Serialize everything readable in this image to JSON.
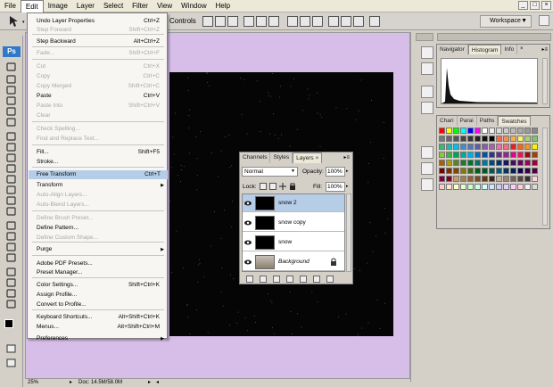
{
  "menubar": {
    "items": [
      "File",
      "Edit",
      "Image",
      "Layer",
      "Select",
      "Filter",
      "View",
      "Window",
      "Help"
    ],
    "active": "Edit",
    "window_controls": [
      "_",
      "□",
      "×"
    ]
  },
  "optionsbar": {
    "controls_label": "Controls",
    "workspace_label": "Workspace",
    "workspace_arrow": "▼"
  },
  "toolbox": {
    "logo": "Ps"
  },
  "edit_menu": {
    "items": [
      {
        "label": "Undo Layer Properties",
        "shortcut": "Ctrl+Z",
        "disabled": false
      },
      {
        "label": "Step Forward",
        "shortcut": "Shift+Ctrl+Z",
        "disabled": true
      },
      {
        "label": "Step Backward",
        "shortcut": "Alt+Ctrl+Z",
        "disabled": false
      },
      {
        "label": "Fade...",
        "shortcut": "Shift+Ctrl+F",
        "disabled": true
      },
      {
        "label": "Cut",
        "shortcut": "Ctrl+X",
        "disabled": true
      },
      {
        "label": "Copy",
        "shortcut": "Ctrl+C",
        "disabled": true
      },
      {
        "label": "Copy Merged",
        "shortcut": "Shift+Ctrl+C",
        "disabled": true
      },
      {
        "label": "Paste",
        "shortcut": "Ctrl+V",
        "disabled": false
      },
      {
        "label": "Paste Into",
        "shortcut": "Shift+Ctrl+V",
        "disabled": true
      },
      {
        "label": "Clear",
        "shortcut": "",
        "disabled": true
      },
      {
        "label": "Check Spelling...",
        "shortcut": "",
        "disabled": true
      },
      {
        "label": "Find and Replace Text...",
        "shortcut": "",
        "disabled": true
      },
      {
        "label": "Fill...",
        "shortcut": "Shift+F5",
        "disabled": false
      },
      {
        "label": "Stroke...",
        "shortcut": "",
        "disabled": false
      },
      {
        "label": "Free Transform",
        "shortcut": "Ctrl+T",
        "disabled": false,
        "highlight": true
      },
      {
        "label": "Transform",
        "shortcut": "",
        "disabled": false,
        "submenu": true
      },
      {
        "label": "Auto-Align Layers...",
        "shortcut": "",
        "disabled": true
      },
      {
        "label": "Auto-Blend Layers...",
        "shortcut": "",
        "disabled": true
      },
      {
        "label": "Define Brush Preset...",
        "shortcut": "",
        "disabled": true
      },
      {
        "label": "Define Pattern...",
        "shortcut": "",
        "disabled": false
      },
      {
        "label": "Define Custom Shape...",
        "shortcut": "",
        "disabled": true
      },
      {
        "label": "Purge",
        "shortcut": "",
        "disabled": false,
        "submenu": true
      },
      {
        "label": "Adobe PDF Presets...",
        "shortcut": "",
        "disabled": false
      },
      {
        "label": "Preset Manager...",
        "shortcut": "",
        "disabled": false
      },
      {
        "label": "Color Settings...",
        "shortcut": "Shift+Ctrl+K",
        "disabled": false
      },
      {
        "label": "Assign Profile...",
        "shortcut": "",
        "disabled": false
      },
      {
        "label": "Convert to Profile...",
        "shortcut": "",
        "disabled": false
      },
      {
        "label": "Keyboard Shortcuts...",
        "shortcut": "Alt+Shift+Ctrl+K",
        "disabled": false
      },
      {
        "label": "Menus...",
        "shortcut": "Alt+Shift+Ctrl+M",
        "disabled": false
      },
      {
        "label": "Preferences",
        "shortcut": "",
        "disabled": false,
        "submenu": true
      }
    ],
    "submenu_arrow": "▶"
  },
  "layers_panel": {
    "tabs": [
      "Channels",
      "Styles",
      "Layers"
    ],
    "active_tab": "Layers",
    "close_glyph": "×",
    "menu_glyph": "▸≡",
    "blend_mode": "Normal",
    "opacity_label": "Opacity:",
    "opacity_value": "100%",
    "lock_label": "Lock:",
    "fill_label": "Fill:",
    "fill_value": "100%",
    "dropdown_arrow": "▼",
    "small_arrow": "▸",
    "layers": [
      {
        "name": "snow  2",
        "selected": true,
        "italic": false,
        "locked": false
      },
      {
        "name": "snow copy",
        "selected": false,
        "italic": false,
        "locked": false
      },
      {
        "name": "snow",
        "selected": false,
        "italic": false,
        "locked": false
      },
      {
        "name": "Background",
        "selected": false,
        "italic": true,
        "locked": true
      }
    ],
    "bottom_buttons": [
      "∞",
      "fx",
      "◐",
      "○",
      "▭",
      "▫",
      "🗑"
    ]
  },
  "right_panels": {
    "top_tabs": [
      "Navigator",
      "Histogram",
      "Info"
    ],
    "top_active": "Histogram",
    "mid_tabs": [
      "Chari",
      "Parai",
      "Paths",
      "Swatches"
    ],
    "mid_active": "Swatches",
    "close_glyph": "×",
    "menu_glyph": "▸≡"
  },
  "status": {
    "zoom": "25%",
    "doc_size": "Doc: 14.5M/58.0M"
  },
  "colors": {
    "canvas_bg": "#050505",
    "pasteboard": "#d6bee8",
    "highlight": "#b6cde8",
    "ps_blue": "#3278c8"
  }
}
